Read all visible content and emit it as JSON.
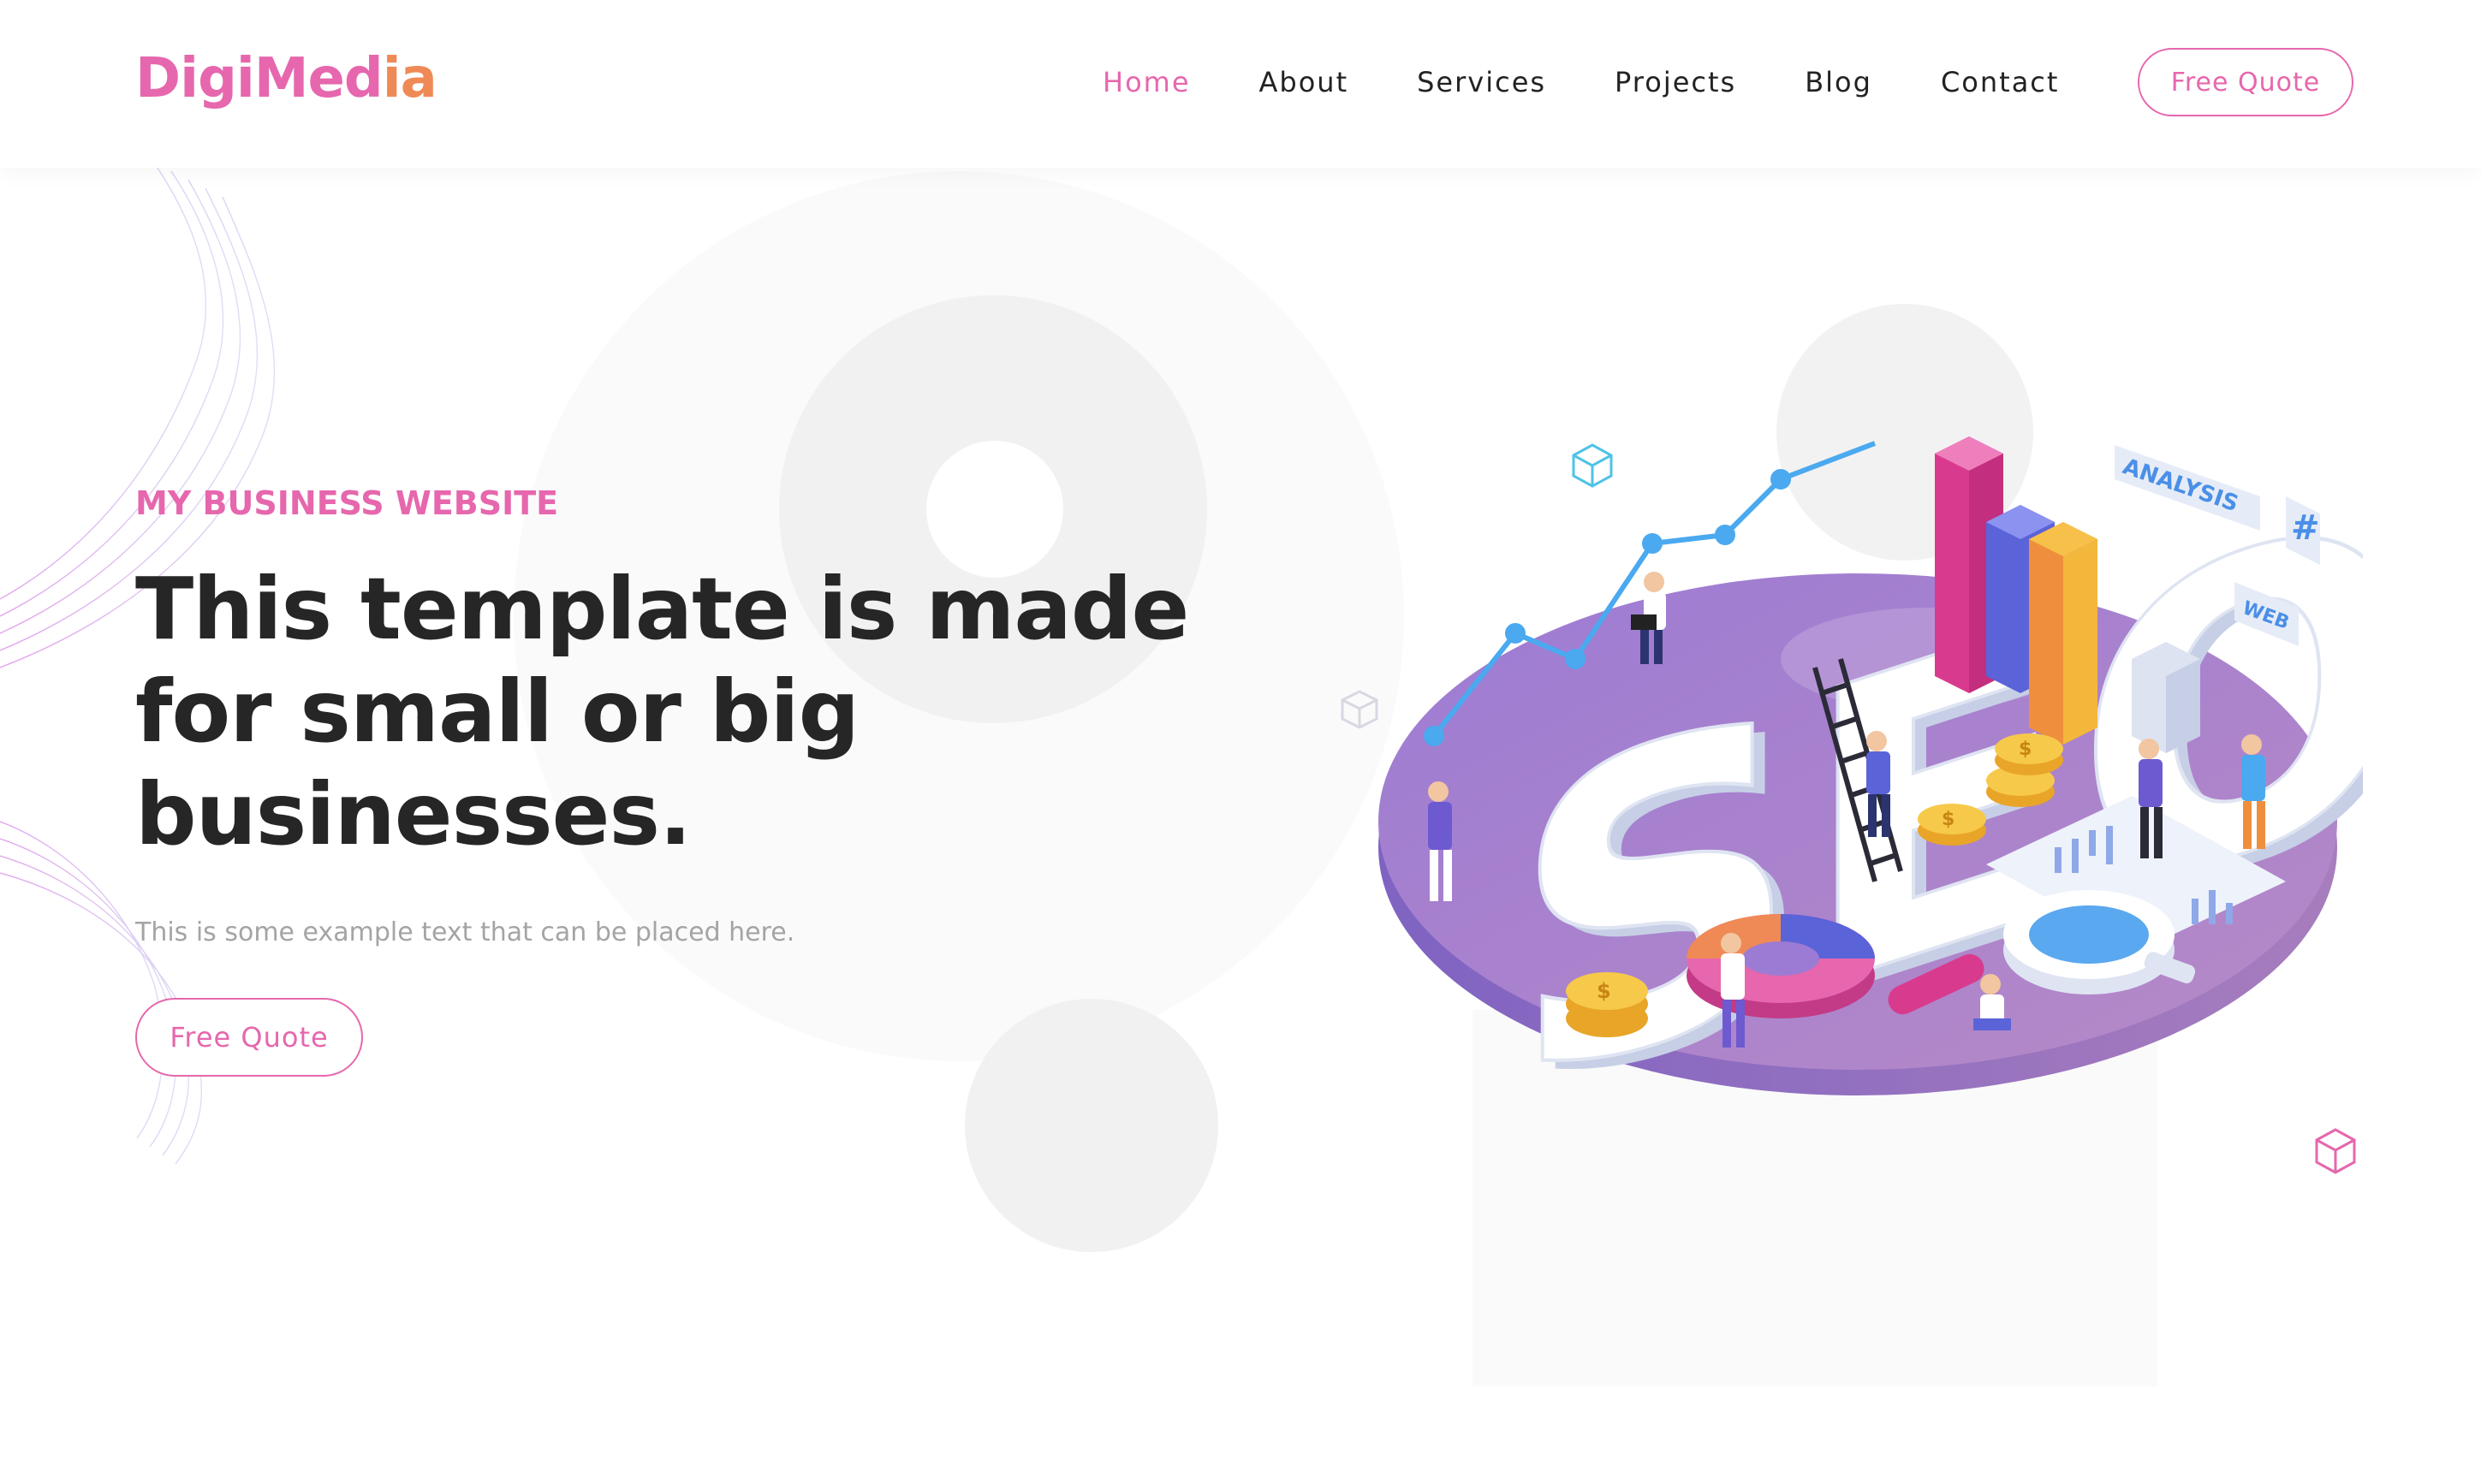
{
  "brand": {
    "logo_part_a": "DigiMed",
    "logo_part_b": "ia",
    "colors": {
      "primary": "#e667ad",
      "accent": "#ef8a56",
      "heading": "#262626",
      "muted": "#a4a4a4"
    }
  },
  "nav": {
    "items": [
      {
        "label": "Home",
        "active": true
      },
      {
        "label": "About",
        "active": false
      },
      {
        "label": "Services",
        "active": false
      },
      {
        "label": "Projects",
        "active": false
      },
      {
        "label": "Blog",
        "active": false
      },
      {
        "label": "Contact",
        "active": false
      }
    ],
    "cta_label": "Free Quote"
  },
  "hero": {
    "eyebrow": "MY BUSINESS WEBSITE",
    "headline": "This template is made for small or big businesses.",
    "subtext": "This is some example text that can be placed here.",
    "cta_label": "Free Quote"
  },
  "illustration": {
    "big_text": "SEO",
    "tags": [
      "ANALYSIS",
      "#",
      "WEB"
    ],
    "coin_symbol": "$"
  }
}
